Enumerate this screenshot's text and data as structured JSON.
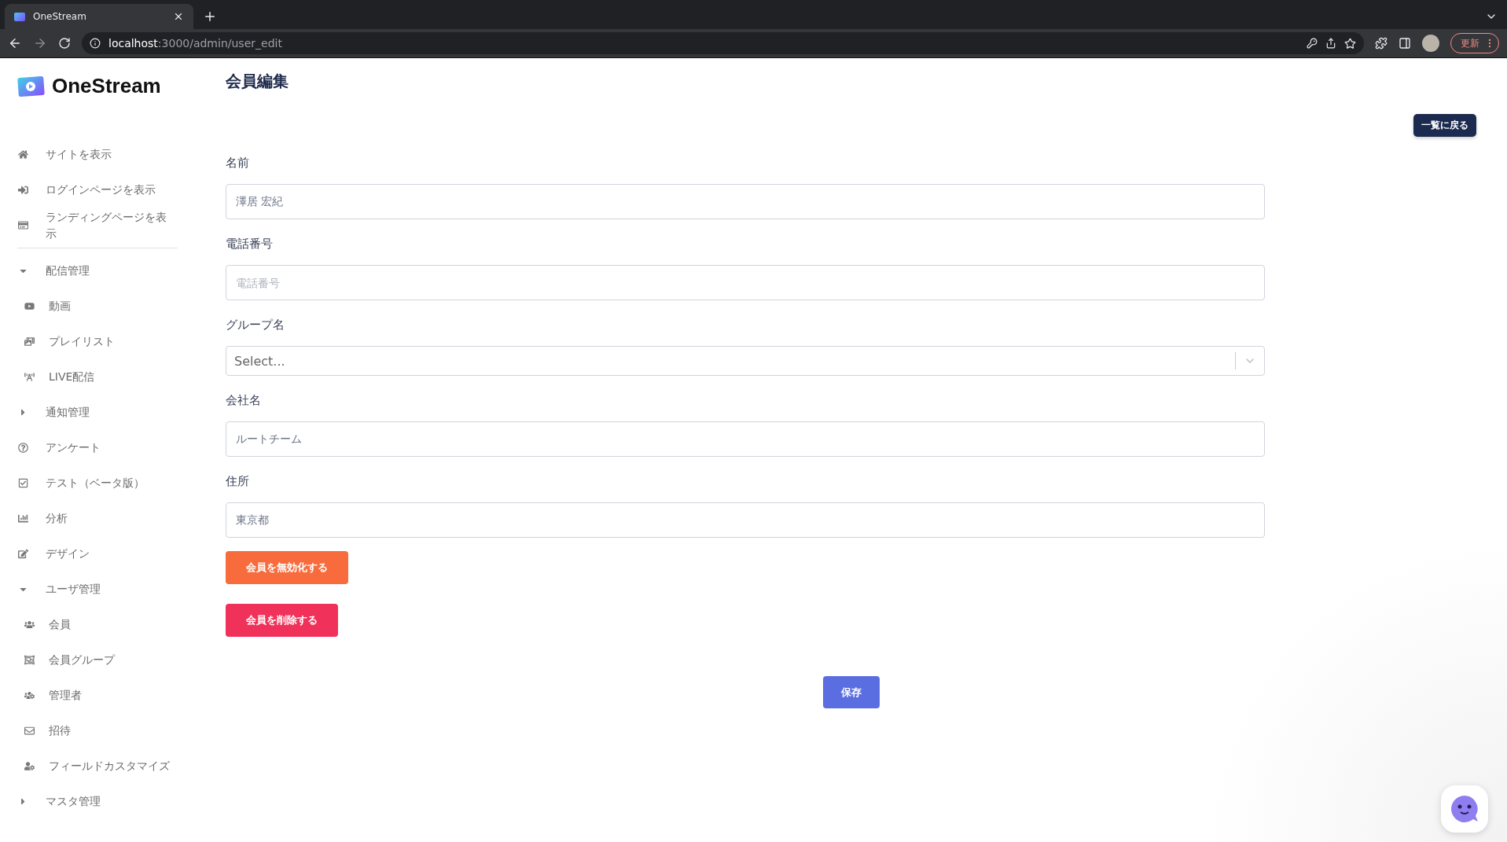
{
  "browser": {
    "tab_title": "OneStream",
    "url_host": "localhost",
    "url_path": ":3000/admin/user_edit",
    "update_label": "更新"
  },
  "sidebar": {
    "logo_text": "OneStream",
    "links": [
      {
        "label": "サイトを表示"
      },
      {
        "label": "ログインページを表示"
      },
      {
        "label": "ランディングページを表示"
      }
    ],
    "menu": [
      {
        "label": "配信管理",
        "kind": "group",
        "expanded": true,
        "children": [
          {
            "label": "動画"
          },
          {
            "label": "プレイリスト"
          },
          {
            "label": "LIVE配信"
          }
        ]
      },
      {
        "label": "通知管理",
        "kind": "group",
        "expanded": false
      },
      {
        "label": "アンケート",
        "kind": "item"
      },
      {
        "label": "テスト（ベータ版）",
        "kind": "item"
      },
      {
        "label": "分析",
        "kind": "item"
      },
      {
        "label": "デザイン",
        "kind": "item"
      },
      {
        "label": "ユーザ管理",
        "kind": "group",
        "expanded": true,
        "children": [
          {
            "label": "会員"
          },
          {
            "label": "会員グループ"
          },
          {
            "label": "管理者"
          },
          {
            "label": "招待"
          },
          {
            "label": "フィールドカスタマイズ"
          }
        ]
      },
      {
        "label": "マスタ管理",
        "kind": "group",
        "expanded": false
      }
    ]
  },
  "page": {
    "title": "会員編集",
    "back_button": "一覧に戻る",
    "fields": [
      {
        "label": "名前",
        "kind": "text",
        "value": "澤居 宏紀"
      },
      {
        "label": "電話番号",
        "kind": "text",
        "placeholder": "電話番号"
      },
      {
        "label": "グループ名",
        "kind": "select",
        "placeholder": "Select..."
      },
      {
        "label": "会社名",
        "kind": "text",
        "value": "ルートチーム"
      },
      {
        "label": "住所",
        "kind": "text",
        "value": "東京都"
      }
    ],
    "actions": [
      {
        "label": "会員を無効化する",
        "kind": "warning"
      },
      {
        "label": "会員を削除する",
        "kind": "danger"
      }
    ],
    "save_button": "保存"
  }
}
